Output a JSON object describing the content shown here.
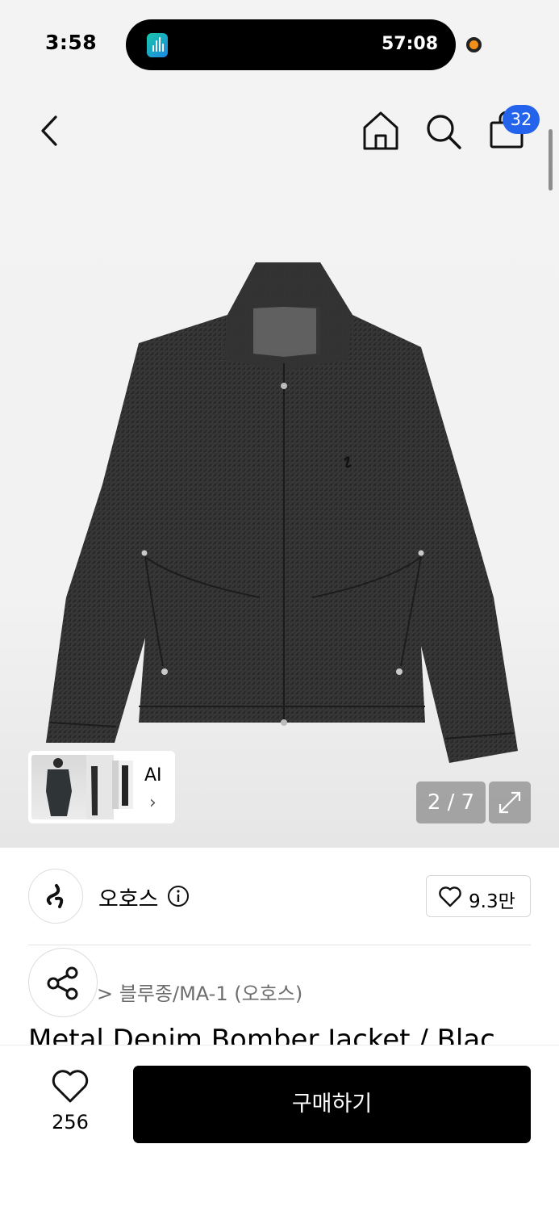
{
  "status_bar": {
    "time": "3:58",
    "activity_timer": "57:08"
  },
  "nav": {
    "cart_count": "32"
  },
  "gallery": {
    "ai_label": "AI",
    "page_counter": "2 / 7"
  },
  "brand": {
    "name": "오호스",
    "likes": "9.3만"
  },
  "product": {
    "category_path": "> 블루종/MA-1 (오호스)",
    "title": "Metal Denim Bomber Jacket / Blac"
  },
  "bottom_bar": {
    "wish_count": "256",
    "buy_label": "구매하기"
  },
  "icons": [
    "back-icon",
    "home-icon",
    "search-icon",
    "cart-icon",
    "expand-icon",
    "info-icon",
    "heart-icon",
    "share-icon"
  ],
  "colors": {
    "badge": "#2463eb",
    "buy_button": "#000000",
    "recording_dot": "#f39019"
  }
}
